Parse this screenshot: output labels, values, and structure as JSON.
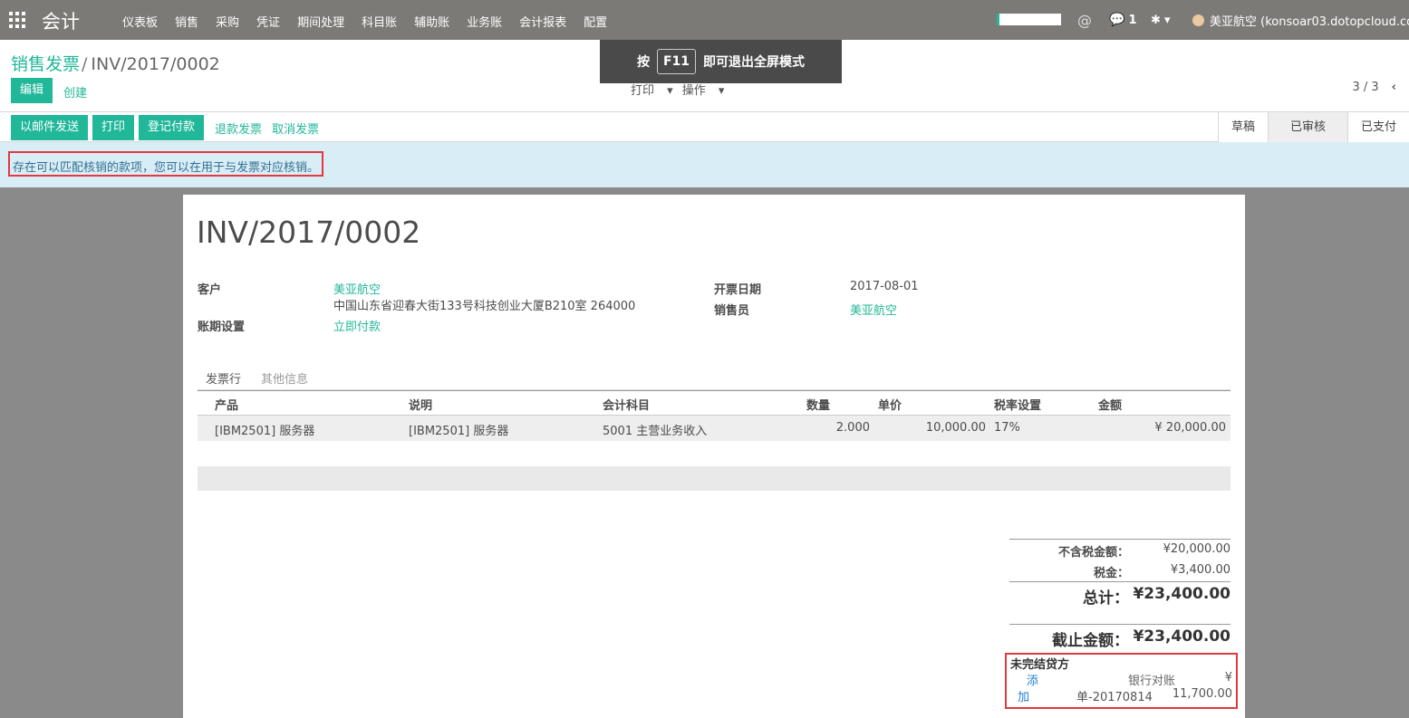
{
  "navbar": {
    "brand": "会计",
    "menu": [
      "仪表板",
      "销售",
      "采购",
      "凭证",
      "期间处理",
      "科目账",
      "辅助账",
      "业务账",
      "会计报表",
      "配置"
    ],
    "chat_count": "1",
    "user": "美亚航空 (konsoar03.dotopcloud.co"
  },
  "breadcrumb": {
    "parent": "销售发票",
    "separator": "/",
    "current": "INV/2017/0002"
  },
  "control": {
    "edit_label": "编辑",
    "create_label": "创建",
    "print_label": "打印",
    "action_label": "操作",
    "pager": "3 / 3"
  },
  "fullscreen_tip": {
    "press": "按",
    "key": "F11",
    "text": "即可退出全屏模式"
  },
  "statusbar": {
    "buttons": [
      "以邮件发送",
      "打印",
      "登记付款"
    ],
    "links": [
      "退款发票",
      "取消发票"
    ],
    "stages": [
      "草稿",
      "已审核",
      "已支付"
    ],
    "active_stage": "已审核"
  },
  "alert": {
    "text": "存在可以匹配核销的款项，您可以在用于与发票对应核销。"
  },
  "invoice": {
    "number": "INV/2017/0002",
    "customer_label": "客户",
    "customer_name": "美亚航空",
    "customer_address": "中国山东省迎春大街133号科技创业大厦B210室 264000",
    "terms_label": "账期设置",
    "terms_value": "立即付款",
    "date_label": "开票日期",
    "date_value": "2017-08-01",
    "salesperson_label": "销售员",
    "salesperson_value": "美亚航空"
  },
  "tabs": {
    "lines": "发票行",
    "other": "其他信息"
  },
  "table": {
    "headers": {
      "product": "产品",
      "description": "说明",
      "account": "会计科目",
      "qty": "数量",
      "price": "单价",
      "tax": "税率设置",
      "amount": "金额"
    },
    "rows": [
      {
        "product": "[IBM2501] 服务器",
        "description": "[IBM2501] 服务器",
        "account": "5001 主营业务收入",
        "qty": "2.000",
        "price": "10,000.00",
        "tax": "17%",
        "amount": "¥ 20,000.00"
      }
    ]
  },
  "totals": {
    "untaxed_label": "不含税金额：",
    "untaxed_value": "¥20,000.00",
    "tax_label": "税金：",
    "tax_value": "¥3,400.00",
    "total_label": "总计：",
    "total_value": "¥23,400.00",
    "due_label": "截止金额：",
    "due_value": "¥23,400.00"
  },
  "outstanding": {
    "title": "未完结贷方",
    "add_1": "添",
    "add_2": "加",
    "desc_1": "银行对账",
    "desc_2": "单-20170814",
    "currency": "¥",
    "amount": "11,700.00"
  },
  "colors": {
    "brand_teal": "#21b799",
    "navbar": "#7c7a76",
    "alert_bg": "#d9edf7",
    "highlight_red": "#e0393e"
  }
}
